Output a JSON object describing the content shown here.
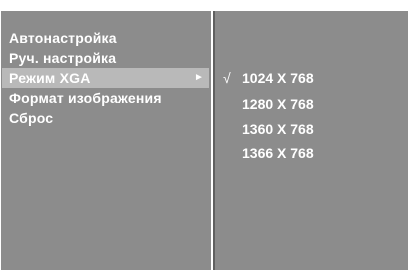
{
  "left_menu": {
    "items": [
      {
        "label": "Автонастройка",
        "selected": false,
        "arrow": ""
      },
      {
        "label": "Руч. настройка",
        "selected": false,
        "arrow": ""
      },
      {
        "label": "Режим XGA",
        "selected": true,
        "arrow": "►"
      },
      {
        "label": "Формат изображения",
        "selected": false,
        "arrow": ""
      },
      {
        "label": "Сброс",
        "selected": false,
        "arrow": ""
      }
    ]
  },
  "xga_options": {
    "check_mark": "√",
    "items": [
      {
        "label": "1024 X 768",
        "checked": true
      },
      {
        "label": "1280 X 768",
        "checked": false
      },
      {
        "label": "1360 X 768",
        "checked": false
      },
      {
        "label": "1366 X 768",
        "checked": false
      }
    ]
  },
  "colors": {
    "panel": "#8c8c8c",
    "highlight": "#b9b9b9",
    "text": "#ffffff"
  }
}
